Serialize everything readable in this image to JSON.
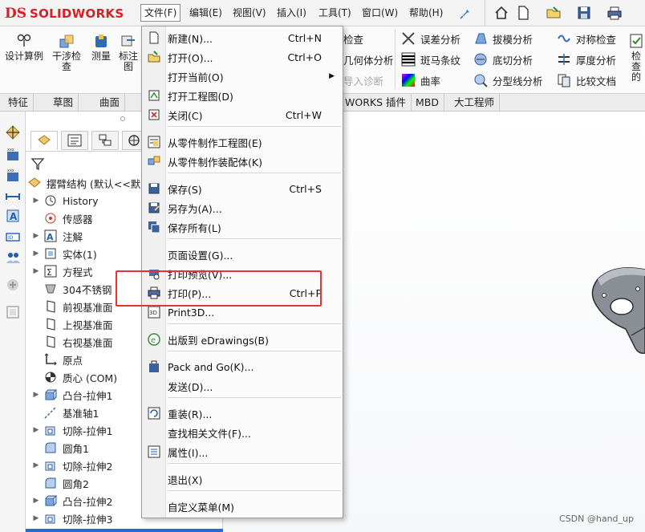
{
  "app": {
    "logo_ds": "DS",
    "logo_name": "SOLIDWORKS",
    "menu": [
      "文件(F)",
      "编辑(E)",
      "视图(V)",
      "插入(I)",
      "工具(T)",
      "窗口(W)",
      "帮助(H)"
    ]
  },
  "ribbon": {
    "left_buttons": [
      "设计算例",
      "干涉检查",
      "测量",
      "标注图"
    ],
    "right_partial": [
      "检查",
      "几何体分析",
      "导入诊断",
      "检查的"
    ],
    "tools": [
      [
        "误差分析",
        "拔模分析",
        "对称检查"
      ],
      [
        "斑马条纹",
        "底切分析",
        "厚度分析"
      ],
      [
        "曲率",
        "分型线分析",
        "比较文档"
      ]
    ]
  },
  "tabs": [
    "特征",
    "草图",
    "曲面",
    "WORKS 插件",
    "MBD",
    "大工程师"
  ],
  "tree": {
    "root": "摆臂结构 (默认<<默",
    "items": [
      {
        "label": "History",
        "icon": "history-icon",
        "exp": true
      },
      {
        "label": "传感器",
        "icon": "sensor-icon",
        "exp": false
      },
      {
        "label": "注解",
        "icon": "annotation-icon",
        "exp": true
      },
      {
        "label": "实体(1)",
        "icon": "solid-body-icon",
        "exp": true
      },
      {
        "label": "方程式",
        "icon": "equation-icon",
        "exp": true
      },
      {
        "label": "304不锈钢",
        "icon": "material-icon",
        "exp": false
      },
      {
        "label": "前视基准面",
        "icon": "plane-icon",
        "exp": false
      },
      {
        "label": "上视基准面",
        "icon": "plane-icon",
        "exp": false
      },
      {
        "label": "右视基准面",
        "icon": "plane-icon",
        "exp": false
      },
      {
        "label": "原点",
        "icon": "origin-icon",
        "exp": false
      },
      {
        "label": "质心 (COM)",
        "icon": "center-of-mass-icon",
        "exp": false
      },
      {
        "label": "凸台-拉伸1",
        "icon": "boss-extrude-icon",
        "exp": true
      },
      {
        "label": "基准轴1",
        "icon": "axis-icon",
        "exp": false
      },
      {
        "label": "切除-拉伸1",
        "icon": "cut-extrude-icon",
        "exp": true
      },
      {
        "label": "圆角1",
        "icon": "fillet-icon",
        "exp": false
      },
      {
        "label": "切除-拉伸2",
        "icon": "cut-extrude-icon",
        "exp": true
      },
      {
        "label": "圆角2",
        "icon": "fillet-icon",
        "exp": false
      },
      {
        "label": "凸台-拉伸2",
        "icon": "boss-extrude-icon",
        "exp": true
      },
      {
        "label": "切除-拉伸3",
        "icon": "cut-extrude-icon",
        "exp": true
      }
    ]
  },
  "file_menu": {
    "items": [
      {
        "label": "新建(N)...",
        "shortcut": "Ctrl+N",
        "icon": "new-document-icon"
      },
      {
        "label": "打开(O)...",
        "shortcut": "Ctrl+O",
        "icon": "open-folder-icon"
      },
      {
        "label": "打开当前(O)",
        "shortcut": "",
        "icon": "",
        "submenu": true
      },
      {
        "label": "打开工程图(D)",
        "shortcut": "",
        "icon": "open-drawing-icon"
      },
      {
        "label": "关闭(C)",
        "shortcut": "Ctrl+W",
        "icon": "close-document-icon"
      },
      {
        "label": "从零件制作工程图(E)",
        "shortcut": "",
        "icon": "make-drawing-icon"
      },
      {
        "label": "从零件制作装配体(K)",
        "shortcut": "",
        "icon": "make-assembly-icon"
      },
      {
        "label": "保存(S)",
        "shortcut": "Ctrl+S",
        "icon": "save-icon"
      },
      {
        "label": "另存为(A)...",
        "shortcut": "",
        "icon": "save-as-icon"
      },
      {
        "label": "保存所有(L)",
        "shortcut": "",
        "icon": "save-all-icon"
      },
      {
        "label": "页面设置(G)...",
        "shortcut": "",
        "icon": ""
      },
      {
        "label": "打印预览(V)...",
        "shortcut": "",
        "icon": "print-preview-icon"
      },
      {
        "label": "打印(P)...",
        "shortcut": "Ctrl+P",
        "icon": "printer-icon"
      },
      {
        "label": "Print3D...",
        "shortcut": "",
        "icon": "print3d-icon"
      },
      {
        "label": "出版到 eDrawings(B)",
        "shortcut": "",
        "icon": "edrawings-icon"
      },
      {
        "label": "Pack and Go(K)...",
        "shortcut": "",
        "icon": "pack-and-go-icon"
      },
      {
        "label": "发送(D)...",
        "shortcut": "",
        "icon": ""
      },
      {
        "label": "重装(R)...",
        "shortcut": "",
        "icon": "reload-icon"
      },
      {
        "label": "查找相关文件(F)...",
        "shortcut": "",
        "icon": ""
      },
      {
        "label": "属性(I)...",
        "shortcut": "",
        "icon": "properties-icon"
      },
      {
        "label": "退出(X)",
        "shortcut": "",
        "icon": ""
      },
      {
        "label": "自定义菜单(M)",
        "shortcut": "",
        "icon": ""
      }
    ]
  },
  "watermark": "CSDN @hand_up",
  "colors": {
    "accent_red": "#e8322b",
    "logo_red": "#d71f26",
    "selection_blue": "#1f6fd1"
  }
}
